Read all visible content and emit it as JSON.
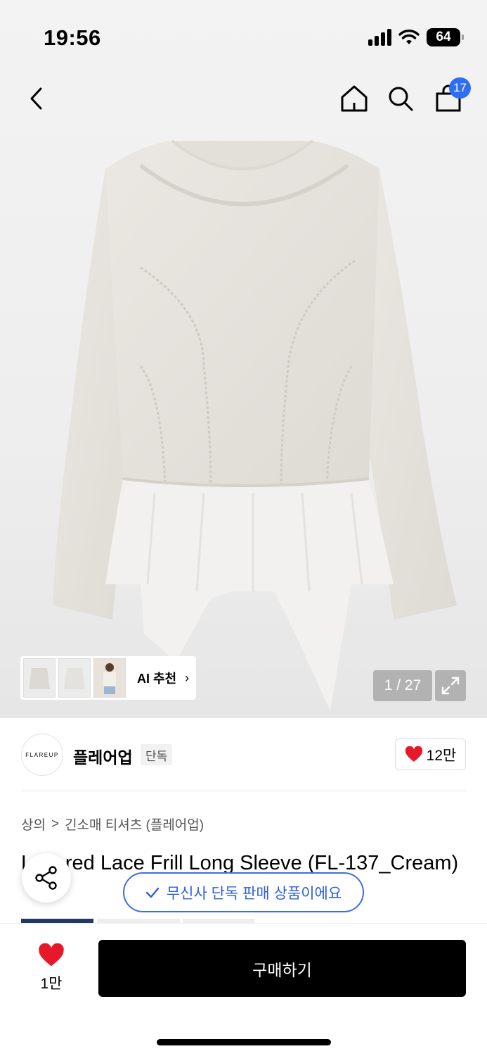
{
  "status_bar": {
    "time": "19:56",
    "battery": "64"
  },
  "nav": {
    "cart_count": "17"
  },
  "gallery": {
    "page_counter": "1 / 27",
    "ai_label": "AI 추천"
  },
  "brand": {
    "logo_text": "FLAREUP",
    "name": "플레어업",
    "badge": "단독",
    "likes": "12만"
  },
  "breadcrumb": {
    "category": "상의",
    "separator": ">",
    "subcategory": "긴소매 티셔츠 (플레어업)"
  },
  "product": {
    "title": "Layered Lace Frill Long Sleeve (FL-137_Cream)"
  },
  "exclusive_notice": "무신사 단독 판매 상품이에요",
  "bottom_bar": {
    "wish_count": "1만",
    "buy_label": "구매하기"
  },
  "colors": {
    "accent_blue": "#2e5fd8",
    "heart_red": "#e8182b",
    "badge_blue": "#2d6ef5"
  }
}
